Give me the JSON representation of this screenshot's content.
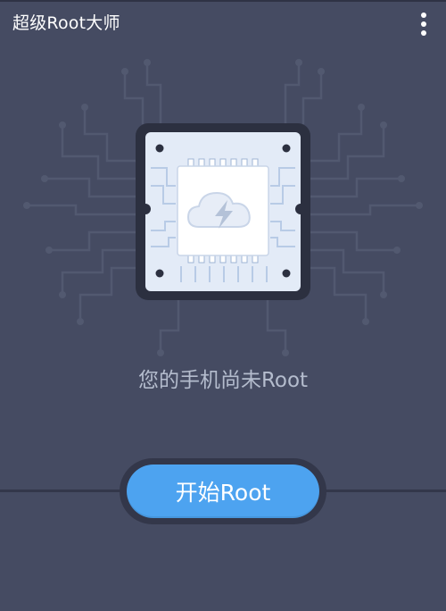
{
  "app_bar": {
    "title": "超级Root大师",
    "menu_icon": "more-vert-icon"
  },
  "chip": {
    "icon": "cloud-lightning-icon"
  },
  "main": {
    "status": "您的手机尚未Root",
    "start_button_label": "开始Root"
  },
  "colors": {
    "background": "#454b62",
    "accent": "#4da3f0",
    "chip_board": "#e3ebf7",
    "status_text": "#b4bccd"
  }
}
